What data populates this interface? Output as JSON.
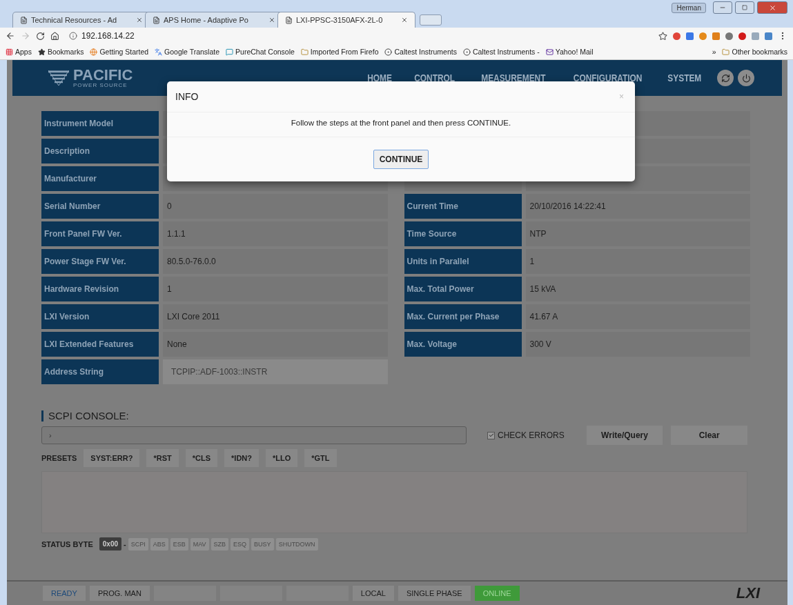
{
  "browser": {
    "tabs": [
      {
        "label": "Technical Resources - Ad",
        "selected": false
      },
      {
        "label": "APS Home - Adaptive Po",
        "selected": false
      },
      {
        "label": "LXI-PPSC-3150AFX-2L-0",
        "selected": true
      }
    ],
    "user": "Herman",
    "url": "192.168.14.22",
    "bookmarks": [
      {
        "label": "Apps",
        "kind": "apps"
      },
      {
        "label": "Bookmarks",
        "kind": "star"
      },
      {
        "label": "Getting Started",
        "kind": "globe"
      },
      {
        "label": "Google Translate",
        "kind": "translate"
      },
      {
        "label": "PureChat Console",
        "kind": "chat"
      },
      {
        "label": "Imported From Firefo",
        "kind": "folder"
      },
      {
        "label": "Caltest Instruments",
        "kind": "badge"
      },
      {
        "label": "Caltest Instruments -",
        "kind": "badge"
      },
      {
        "label": "Yahoo! Mail",
        "kind": "mail"
      }
    ],
    "overflow": "»",
    "other_bookmarks": "Other bookmarks"
  },
  "header": {
    "logo": "PACIFIC",
    "logo_sub": "POWER SOURCE",
    "nav": [
      "HOME",
      "CONTROL",
      "MEASUREMENT",
      "CONFIGURATION",
      "SYSTEM"
    ]
  },
  "info_left": [
    {
      "label": "Instrument Model"
    },
    {
      "label": "Description"
    },
    {
      "label": "Manufacturer"
    },
    {
      "label": "Serial Number",
      "value": "0"
    },
    {
      "label": "Front Panel FW Ver.",
      "value": "1.1.1"
    },
    {
      "label": "Power Stage FW Ver.",
      "value": "80.5.0-76.0.0"
    },
    {
      "label": "Hardware Revision",
      "value": "1"
    },
    {
      "label": "LXI Version",
      "value": "LXI Core 2011"
    },
    {
      "label": "LXI Extended Features",
      "value": "None"
    },
    {
      "label": "Address String",
      "value": "TCPIP::ADF-1003::INSTR",
      "kind": "field"
    }
  ],
  "info_right": [
    {
      "label": "Current Time",
      "value": "20/10/2016 14:22:41"
    },
    {
      "label": "Time Source",
      "value": "NTP"
    },
    {
      "label": "Units in Parallel",
      "value": "1"
    },
    {
      "label": "Max. Total Power",
      "value": "15 kVA"
    },
    {
      "label": "Max. Current per Phase",
      "value": "41.67 A"
    },
    {
      "label": "Max. Voltage",
      "value": "300 V"
    }
  ],
  "console": {
    "title": "SCPI CONSOLE:",
    "prompt": "›",
    "check_errors": {
      "label": "CHECK ERRORS",
      "checked": true
    },
    "buttons": [
      "Write/Query",
      "Clear"
    ],
    "presets_label": "PRESETS",
    "presets": [
      "SYST:ERR?",
      "*RST",
      "*CLS",
      "*IDN?",
      "*LLO",
      "*GTL"
    ],
    "status_byte_label": "STATUS BYTE",
    "status_byte_value": "0x00",
    "separator": "-",
    "bits": [
      {
        "label": "SCPI",
        "disabled": true
      },
      {
        "label": "ABS",
        "disabled": true
      },
      {
        "label": "ESB",
        "disabled": true
      },
      {
        "label": "MAV",
        "disabled": true
      },
      {
        "label": "SZB",
        "disabled": true
      },
      {
        "label": "ESQ",
        "disabled": true
      },
      {
        "label": "BUSY",
        "disabled": true
      },
      {
        "label": "SHUTDOWN",
        "disabled": true
      }
    ]
  },
  "status_bar": {
    "items": [
      {
        "label": "READY",
        "kind": "ready"
      },
      {
        "label": "PROG. MAN",
        "kind": "plain"
      },
      {
        "kind": "blank"
      },
      {
        "kind": "blank"
      },
      {
        "kind": "blank"
      },
      {
        "label": "LOCAL",
        "kind": "plain"
      },
      {
        "label": "SINGLE PHASE",
        "kind": "plain"
      },
      {
        "label": "ONLINE",
        "kind": "online"
      }
    ],
    "logo": "LXI"
  },
  "dialog": {
    "title": "INFO",
    "close": "×",
    "message": "Follow the steps at the front panel and then press CONTINUE.",
    "button": "CONTINUE"
  }
}
